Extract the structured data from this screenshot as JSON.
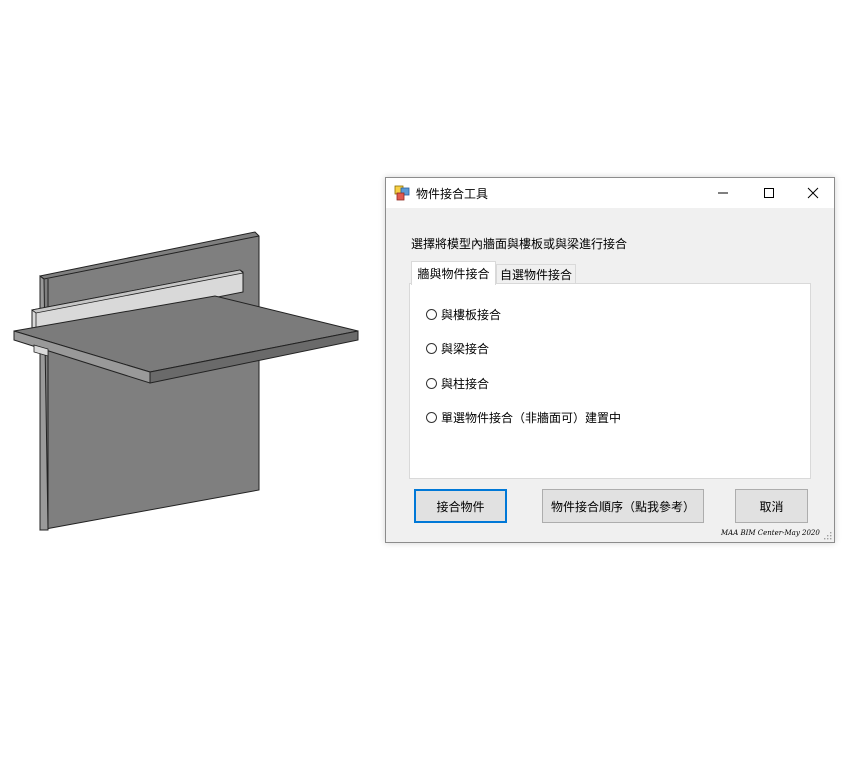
{
  "model": {
    "name": "wall-slab-beam-3d-model"
  },
  "window": {
    "title": "物件接合工具",
    "icon": "app-icon",
    "controls": {
      "minimize_icon": "minimize-icon",
      "maximize_icon": "maximize-icon",
      "close_icon": "close-icon"
    }
  },
  "instruction": "選擇將模型內牆面與樓板或與梁進行接合",
  "tabs": [
    {
      "label": "牆與物件接合",
      "active": true
    },
    {
      "label": "自選物件接合",
      "active": false
    }
  ],
  "options": [
    {
      "label": "與樓板接合",
      "checked": false
    },
    {
      "label": "與梁接合",
      "checked": false
    },
    {
      "label": "與柱接合",
      "checked": false
    },
    {
      "label": "單選物件接合（非牆面可）建置中",
      "checked": false
    }
  ],
  "buttons": {
    "join": "接合物件",
    "order": "物件接合順序（點我參考）",
    "cancel": "取消"
  },
  "credit": "MAA BIM Center-May 2020",
  "colors": {
    "accent": "#0078d7",
    "model_gray": "#7f7f7f",
    "beam_light": "#d9d9d9"
  }
}
